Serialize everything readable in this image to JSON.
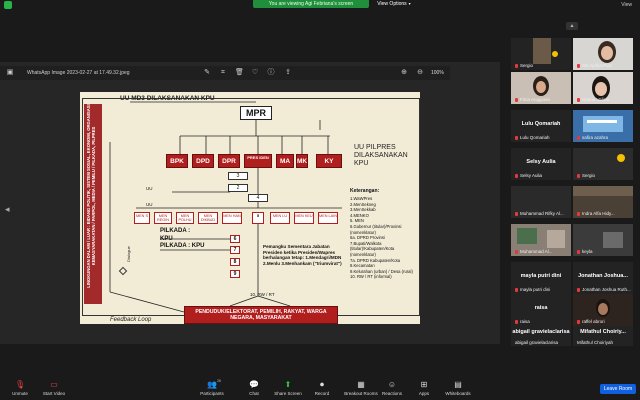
{
  "top": {
    "viewing_text": "You are viewing Agi Febriana's screen",
    "view_options": "View Options",
    "view_label": "View"
  },
  "viewer": {
    "title": "WhatsApp Image 2023-02-27 at 17.49.32.jpeg",
    "zoom": "100%"
  },
  "slide": {
    "title": "UU MD3 DILAKSANAKAN KPU",
    "left_band_text": "LINGKUNGAN DALAM / LUAR : BIDANG POLITIK, SISTEM SOSIAL, EKONOMI, ORGANISASI KEMASYARAKATAN / PARPOL, MEDIA / PEMILU / PILKADA, PILPRES",
    "mpr": "MPR",
    "institutions": [
      "BPK",
      "DPD",
      "DPR",
      "PRES IDEN",
      "MA",
      "MK",
      "KY"
    ],
    "pilpres": "UU PILPRES DILAKSANAKAN KPU",
    "ket_title": "Keterangan:",
    "ket_items": [
      "1.WaWPres",
      "2.MenSekneg",
      "3.MenSekkab",
      "4.MENKO",
      "5. MEN",
      "6.Gubernur (titular)/Provinsi (nomenklatur)",
      "6a. DPRD Provinsi",
      "7.Bupati/Walkota (titular)/Kabupaten/Kota (nomenklatur)",
      "7a. DPRD Kabupaten/Kota",
      "8.Kecamatan",
      "9.Kelurahan (urban) / Desa (rural)",
      "10. RW / RT (informal)"
    ],
    "small_2": "2",
    "small_3": "3",
    "small_4": "4",
    "ministers": [
      "MEN S",
      "MEN REGIN",
      "MEN POLHU",
      "MEN DIKBUD",
      "MEN HAN",
      "MEN LU",
      "MEN KEU",
      "MEN LAIN"
    ],
    "uu_top": "UU",
    "pilkada_1": "PILKADA :",
    "kpu_1": "KPU",
    "pilkada_2": "PILKADA : KPU",
    "uu_label": "UU",
    "num_6": "6",
    "num_7": "7",
    "num_8": "8",
    "num_9": "9",
    "pemangku": "Pemangku Sementara Jabatan Presiden ketika Presiden/Wapres berhalangan tetap: 1.Mendagri/MDN 2.Menlu 3.Menhankam (\"triumvirat\")",
    "rw_rt": "10. RW / RT",
    "people": "PENDUDUK/ELEKTORAT, PEMILIH, RAKYAT, WARGA NEGARA, MASYARAKAT",
    "feedback": "Feedback Loop",
    "dialogue": "Dialogue"
  },
  "gallery": {
    "tiles": [
      {
        "name": "Sergio"
      },
      {
        "name": "Siti Aprilia Putri"
      },
      {
        "name": "Fitria Anggraini"
      },
      {
        "name": "Gracia Valicia"
      },
      {
        "name": "Lulu Qomariah",
        "big": "Lulu Qomariah"
      },
      {
        "name": "safira azahra"
      },
      {
        "name": "Selsy Aulia",
        "big": "Selsy Aulia"
      },
      {
        "name": "Sergio"
      },
      {
        "name": "Muhammad Rifky Al..."
      },
      {
        "name": "Indra Alfa Hidy..."
      },
      {
        "name": "Muhammad Al..."
      },
      {
        "name": "keyla"
      },
      {
        "name": "mayla putri dini",
        "big": "mayla putri dini"
      },
      {
        "name": "Jonathan Joshua Ruth...",
        "big": "Jonathan Joshua..."
      },
      {
        "name": "raisa",
        "big": "raisa"
      },
      {
        "name": "raffel abrori"
      },
      {
        "name": "abigail gravielaclarisa",
        "big": "abigail gravielaclarisa"
      },
      {
        "name": "Mifathul Choiriyah",
        "big": "Mifathul Choiriy..."
      }
    ]
  },
  "toolbar": {
    "unmute": "Unmute",
    "start_video": "Start Video",
    "participants": "Participants",
    "participants_count": "26",
    "chat": "Chat",
    "share_screen": "Share Screen",
    "record": "Record",
    "breakout": "Breakout Rooms",
    "reactions": "Reactions",
    "apps": "Apps",
    "whiteboards": "Whiteboards",
    "leave": "Leave Room"
  },
  "colors": {
    "accent_green": "#1f8f3c",
    "slide_red": "#b11e1e",
    "leave_blue": "#1060e0"
  }
}
